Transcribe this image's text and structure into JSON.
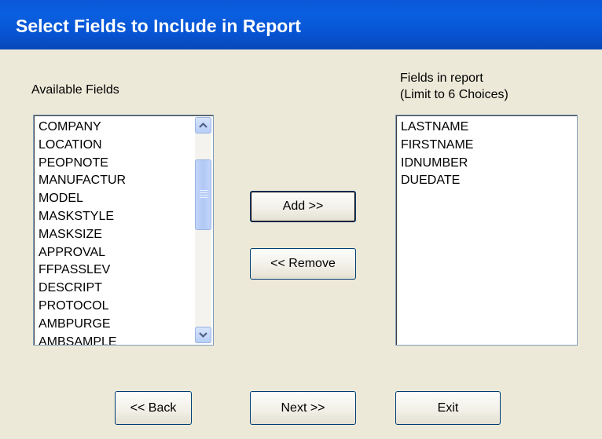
{
  "dialog": {
    "title": "Select Fields to Include in Report"
  },
  "available": {
    "label": "Available Fields",
    "items": [
      "COMPANY",
      "LOCATION",
      "PEOPNOTE",
      "MANUFACTUR",
      "MODEL",
      "MASKSTYLE",
      "MASKSIZE",
      "APPROVAL",
      "FFPASSLEV",
      "DESCRIPT",
      "PROTOCOL",
      "AMBPURGE",
      "AMBSAMPLE"
    ]
  },
  "selected": {
    "label_line1": "Fields in report",
    "label_line2": "(Limit to 6 Choices)",
    "items": [
      "LASTNAME",
      "FIRSTNAME",
      "IDNUMBER",
      "DUEDATE"
    ]
  },
  "buttons": {
    "add": "Add >>",
    "remove": "<< Remove",
    "back": "<< Back",
    "next": "Next >>",
    "exit": "Exit"
  }
}
